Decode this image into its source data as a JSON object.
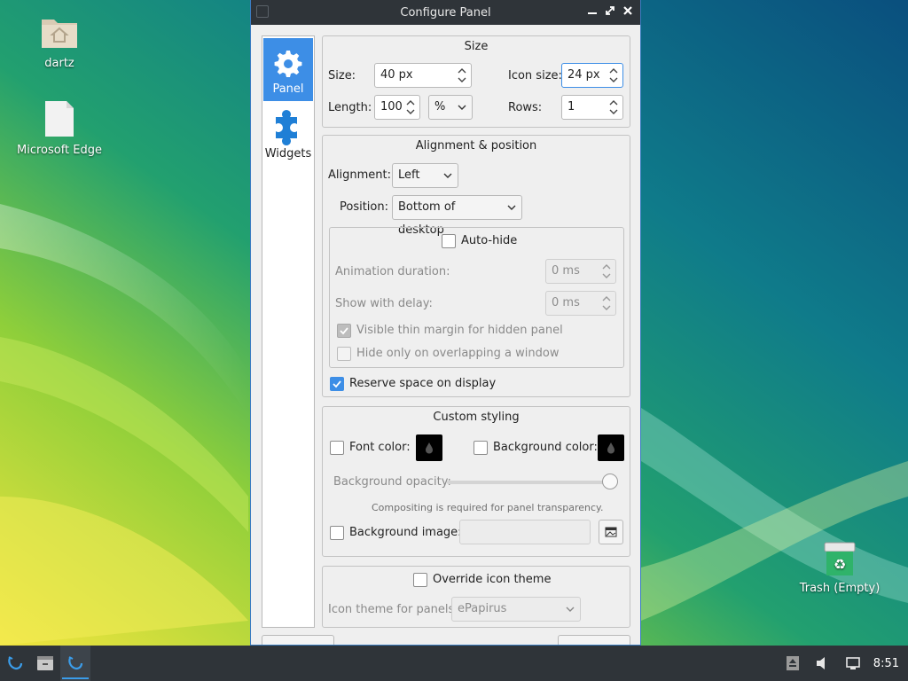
{
  "desktop": {
    "icons": [
      {
        "label": "dartz",
        "icon": "home-folder-icon"
      },
      {
        "label": "Microsoft Edge",
        "icon": "document-icon"
      },
      {
        "label": "Trash (Empty)",
        "icon": "trash-icon"
      }
    ]
  },
  "dialog": {
    "title": "Configure Panel",
    "sidebar": [
      {
        "label": "Panel",
        "icon": "gear-icon",
        "selected": true
      },
      {
        "label": "Widgets",
        "icon": "puzzle-icon",
        "selected": false
      }
    ],
    "size": {
      "title": "Size",
      "size_label": "Size:",
      "size_value": "40 px",
      "icon_size_label": "Icon size:",
      "icon_size_value": "24 px",
      "length_label": "Length:",
      "length_value": "100",
      "length_unit": "%",
      "rows_label": "Rows:",
      "rows_value": "1"
    },
    "alignment": {
      "title": "Alignment & position",
      "alignment_label": "Alignment:",
      "alignment_value": "Left",
      "position_label": "Position:",
      "position_value": "Bottom of desktop",
      "autohide_label": "Auto-hide",
      "animation_label": "Animation duration:",
      "animation_value": "0 ms",
      "delay_label": "Show with delay:",
      "delay_value": "0 ms",
      "thin_margin_label": "Visible thin margin for hidden panel",
      "overlap_label": "Hide only on overlapping a window",
      "reserve_label": "Reserve space on display"
    },
    "styling": {
      "title": "Custom styling",
      "font_color_label": "Font color:",
      "bg_color_label": "Background color:",
      "opacity_label": "Background opacity:",
      "opacity_fraction": 1.0,
      "compositing_note": "Compositing is required for panel transparency.",
      "bg_image_label": "Background image:"
    },
    "icon_theme": {
      "override_label": "Override icon theme",
      "theme_label": "Icon theme for panels:",
      "theme_value": "ePapirus"
    }
  },
  "taskbar": {
    "clock": "8:51"
  },
  "colors": {
    "accent": "#3d8ee6",
    "taskbar": "#2f3439"
  }
}
